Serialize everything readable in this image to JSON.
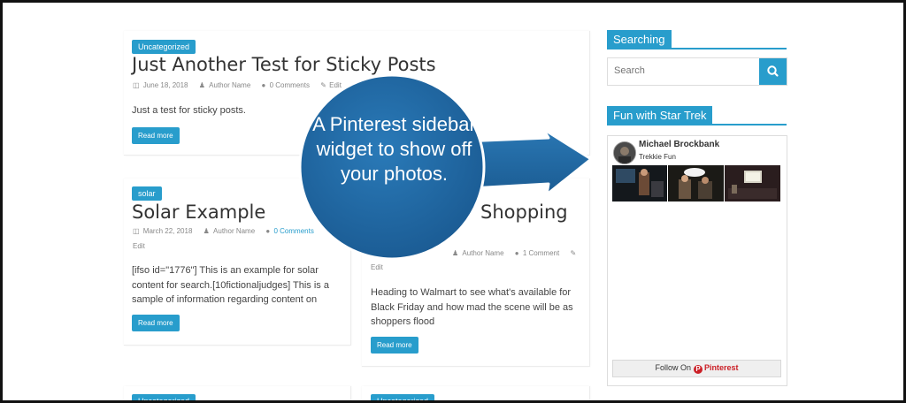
{
  "posts": [
    {
      "category": "Uncategorized",
      "title": "Just Another Test for Sticky Posts",
      "date": "June 18, 2018",
      "author": "Author Name",
      "comments": "0 Comments",
      "edit": "Edit",
      "excerpt": "Just a test for sticky posts.",
      "read_more": "Read more"
    },
    {
      "category": "solar",
      "title": "Solar Example",
      "date": "March 22, 2018",
      "author": "Author Name",
      "comments": "0 Comments",
      "edit": "Edit",
      "excerpt": "[ifso id=\"1776\"] This is an example for solar content for search.[10fictionaljudges] This is a sample of information regarding content on",
      "read_more": "Read more"
    },
    {
      "title_visible": "Shopping",
      "author": "Author Name",
      "comments": "1 Comment",
      "edit": "Edit",
      "excerpt": "Heading to Walmart to see what's available for Black Friday and how mad the scene will be as shoppers flood",
      "read_more": "Read more"
    }
  ],
  "bottom_categories": [
    "Uncategorized",
    "Uncategorized"
  ],
  "sidebar": {
    "search_widget": {
      "title": "Searching",
      "placeholder": "Search",
      "button_icon": "search-icon"
    },
    "pinterest_widget": {
      "title": "Fun with Star Trek",
      "profile_name": "Michael Brockbank",
      "board_name": "Trekkie Fun",
      "follow_label": "Follow On",
      "pinterest_label": "Pinterest"
    }
  },
  "annotation": {
    "text": "A Pinterest sidebar widget to show off your photos."
  },
  "colors": {
    "accent": "#289dcc",
    "bubble": "#1e5f97",
    "pinterest_red": "#cb2027",
    "frame": "#111111"
  }
}
